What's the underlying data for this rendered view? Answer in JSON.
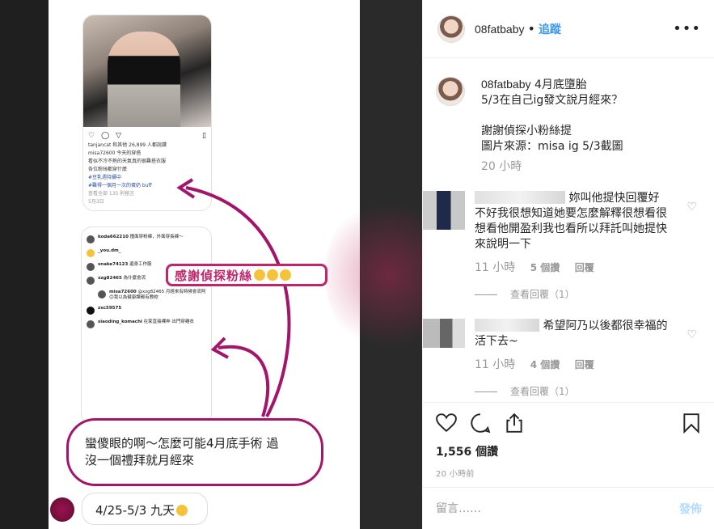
{
  "header": {
    "username": "08fatbaby",
    "separator": "•",
    "follow_label": "追蹤",
    "more_label": "•••"
  },
  "caption": {
    "username": "08fatbaby",
    "title": "4月底墮胎",
    "line1": "5/3在自己ig發文說月經來？",
    "line2": "謝謝偵探小粉絲提",
    "line3": "圖片來源：misa ig 5/3截圖",
    "time": "20 小時"
  },
  "comments": [
    {
      "text": "妳叫他提快回覆好不好我很想知道她要怎麼解釋很想看很想看他開盈利我也看所以拜託叫她提快來說明一下",
      "time": "11 小時",
      "likes": "5 個讚",
      "reply": "回覆",
      "view_replies": "查看回覆（1）"
    },
    {
      "text": "希望阿乃以後都很幸福的活下去~",
      "time": "11 小時",
      "likes": "4 個讚",
      "reply": "回覆",
      "view_replies": "查看回覆（1）"
    }
  ],
  "stats": {
    "likes": "1,556 個讚",
    "timestamp": "20 小時前"
  },
  "comment_box": {
    "placeholder": "留言……",
    "post_label": "發佈"
  },
  "image": {
    "banner": "感謝偵探粉絲",
    "caption_line1": "蠻傻眼的啊～怎麼可能4月底手術 過",
    "caption_line2": "沒一個禮拜就月經來",
    "date_range": "4/25-5/3 九天",
    "screenshot_lines": [
      "tanjancat 和其他 26,899 人都說讚",
      "misa72600 今天的穿搭",
      "看似不冷不熱的天氣真的很難搭衣服",
      "各位粉絲都穿什麼",
      "#豆乳週持續中",
      "#難得一個月一次的蛋奶 buff",
      "查看全部 135 則留言",
      "5月3日"
    ],
    "screenshot_comments": [
      {
        "user": "koda662210",
        "text": "撞面穿粉褲，外面穿長褲～"
      },
      {
        "user": "_you.dm_",
        "text": ""
      },
      {
        "user": "snake74123",
        "text": "還身工作服"
      },
      {
        "user": "xzg82465",
        "text": "為什麼會流"
      },
      {
        "user": "misa72600",
        "text": "@xzg82465 月經來有時候會流阿🙃我以為健康課都有教欸"
      },
      {
        "user": "zxc59575",
        "text": ""
      },
      {
        "user": "siaoding_komachi",
        "text": "在家直接裸奔 出門穿雞衣"
      }
    ]
  },
  "colors": {
    "accent": "#3897f0",
    "magenta": "#c2246b"
  }
}
